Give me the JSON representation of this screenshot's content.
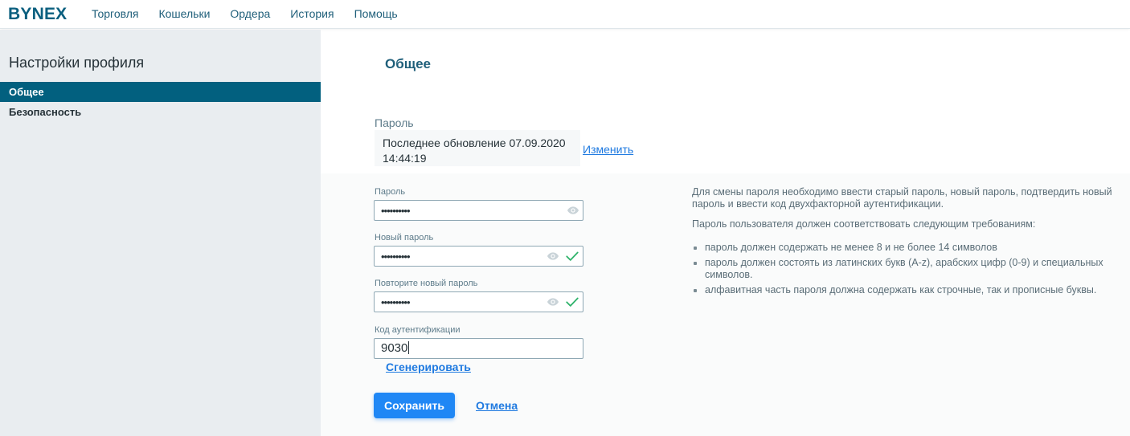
{
  "app": {
    "logo": "BYNEX"
  },
  "nav": {
    "items": [
      {
        "label": "Торговля"
      },
      {
        "label": "Кошельки"
      },
      {
        "label": "Ордера"
      },
      {
        "label": "История"
      },
      {
        "label": "Помощь"
      }
    ]
  },
  "sidebar": {
    "title": "Настройки профиля",
    "items": [
      {
        "label": "Общее",
        "active": true
      },
      {
        "label": "Безопасность",
        "active": false
      }
    ]
  },
  "main": {
    "title": "Общее",
    "password_section": {
      "label": "Пароль",
      "last_update_line1": "Последнее обновление 07.09.2020",
      "last_update_line2": "14:44:19",
      "change_link": "Изменить"
    },
    "form": {
      "password": {
        "label": "Пароль",
        "value": "••••••••••"
      },
      "new_password": {
        "label": "Новый пароль",
        "value": "••••••••••"
      },
      "repeat_password": {
        "label": "Повторите новый пароль",
        "value": "••••••••••"
      },
      "auth_code": {
        "label": "Код аутентификации",
        "value": "9030"
      },
      "generate_link": "Сгенерировать",
      "save_button": "Сохранить",
      "cancel_link": "Отмена"
    },
    "info": {
      "paragraph1": "Для смены пароля необходимо ввести старый пароль, новый пароль, подтвердить новый пароль и ввести код двухфакторной аутентификации.",
      "paragraph2": "Пароль пользователя должен соответствовать следующим требованиям:",
      "requirements": [
        "пароль должен содержать не менее 8 и не более 14 символов",
        "пароль должен состоять из латинских букв (A-z), арабских цифр (0-9) и специальных символов.",
        "алфавитная часть пароля должна содержать как строчные, так и прописные буквы."
      ]
    }
  },
  "colors": {
    "accent": "#02607f",
    "link": "#1f7ae0",
    "button": "#1f87f5",
    "valid": "#2fb36b"
  }
}
